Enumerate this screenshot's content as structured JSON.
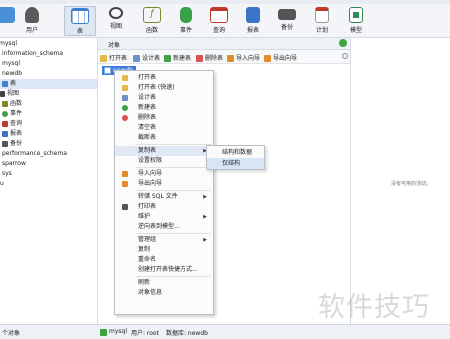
{
  "window": {
    "top_menu_fragments": [
      "...",
      "...",
      "..."
    ]
  },
  "toolbar": {
    "items": [
      {
        "label": "",
        "icon": "connection-icon",
        "color": "#4a90d9"
      },
      {
        "label": "用户",
        "icon": "user-icon",
        "color": "#555555"
      },
      {
        "label": "表",
        "icon": "table-icon",
        "color": "#3f7fd0"
      },
      {
        "label": "视图",
        "icon": "view-icon",
        "color": "#444444"
      },
      {
        "label": "函数",
        "icon": "function-icon",
        "color": "#7a8a2a"
      },
      {
        "label": "事件",
        "icon": "event-icon",
        "color": "#3aa04a"
      },
      {
        "label": "查询",
        "icon": "query-icon",
        "color": "#c0392b"
      },
      {
        "label": "报表",
        "icon": "report-icon",
        "color": "#3b73c7"
      },
      {
        "label": "备份",
        "icon": "backup-icon",
        "color": "#555555"
      },
      {
        "label": "计划",
        "icon": "schedule-icon",
        "color": "#c0392b"
      },
      {
        "label": "模型",
        "icon": "model-icon",
        "color": "#2e8b57"
      }
    ]
  },
  "sidebar": {
    "rows": [
      {
        "label": "mysql",
        "icon": "database-icon",
        "indent": 0,
        "selected": false
      },
      {
        "label": "information_schema",
        "icon": "database-icon",
        "indent": 0,
        "selected": false
      },
      {
        "label": "mysql",
        "icon": "database-icon",
        "indent": 0,
        "selected": false
      },
      {
        "label": "newdb",
        "icon": "database-icon",
        "indent": 0,
        "selected": false
      },
      {
        "label": "表",
        "icon": "table-icon",
        "indent": 1,
        "selected": true
      },
      {
        "label": "视图",
        "icon": "view-icon",
        "indent": 1,
        "selected": false
      },
      {
        "label": "函数",
        "icon": "function-icon",
        "indent": 1,
        "selected": false
      },
      {
        "label": "事件",
        "icon": "event-icon",
        "indent": 1,
        "selected": false
      },
      {
        "label": "查询",
        "icon": "query-icon",
        "indent": 1,
        "selected": false
      },
      {
        "label": "报表",
        "icon": "report-icon",
        "indent": 1,
        "selected": false
      },
      {
        "label": "备份",
        "icon": "backup-icon",
        "indent": 1,
        "selected": false
      },
      {
        "label": "performance_schema",
        "icon": "database-icon",
        "indent": 0,
        "selected": false
      },
      {
        "label": "sparrow",
        "icon": "database-icon",
        "indent": 0,
        "selected": false
      },
      {
        "label": "sys",
        "icon": "database-icon",
        "indent": 0,
        "selected": false
      },
      {
        "label": "u",
        "icon": "database-icon",
        "indent": 0,
        "selected": false
      }
    ]
  },
  "objects": {
    "header": "对象",
    "toolbar": [
      {
        "label": "打开表",
        "icon": "open-table-icon"
      },
      {
        "label": "设计表",
        "icon": "design-table-icon"
      },
      {
        "label": "新建表",
        "icon": "new-table-icon"
      },
      {
        "label": "删除表",
        "icon": "delete-table-icon"
      },
      {
        "label": "导入向导",
        "icon": "import-icon"
      },
      {
        "label": "导出向导",
        "icon": "export-icon"
      }
    ],
    "selected_item": "newdb"
  },
  "context_menu": {
    "items": [
      {
        "label": "打开表",
        "icon": "open-table-icon",
        "submenu": false
      },
      {
        "label": "打开表 (快速)",
        "icon": "open-table-icon",
        "submenu": false
      },
      {
        "label": "设计表",
        "icon": "design-table-icon",
        "submenu": false
      },
      {
        "label": "新建表",
        "icon": "new-table-icon",
        "submenu": false
      },
      {
        "label": "删除表",
        "icon": "delete-table-icon",
        "submenu": false
      },
      {
        "label": "清空表",
        "icon": "",
        "submenu": false
      },
      {
        "label": "截断表",
        "icon": "",
        "submenu": false
      },
      {
        "label": "复制表",
        "icon": "",
        "submenu": true,
        "highlight": true
      },
      {
        "label": "设置权限",
        "icon": "",
        "submenu": false
      },
      {
        "label": "导入向导",
        "icon": "import-icon",
        "submenu": false
      },
      {
        "label": "导出向导",
        "icon": "export-icon",
        "submenu": false
      },
      {
        "label": "转储 SQL 文件",
        "icon": "",
        "submenu": true
      },
      {
        "label": "打印表",
        "icon": "print-icon",
        "submenu": false
      },
      {
        "label": "维护",
        "icon": "",
        "submenu": true
      },
      {
        "label": "逆向表到模型...",
        "icon": "",
        "submenu": false
      },
      {
        "label": "管理组",
        "icon": "",
        "submenu": true
      },
      {
        "label": "复制",
        "icon": "",
        "submenu": false
      },
      {
        "label": "重命名",
        "icon": "",
        "submenu": false
      },
      {
        "label": "创建打开表快捷方式...",
        "icon": "",
        "submenu": false
      },
      {
        "label": "刷新",
        "icon": "",
        "submenu": false
      },
      {
        "label": "对象信息",
        "icon": "",
        "submenu": false
      }
    ],
    "submenu": [
      {
        "label": "结构和数据",
        "highlight": false
      },
      {
        "label": "仅结构",
        "highlight": true
      }
    ]
  },
  "info_panel": {
    "text": "没有可用的活动。"
  },
  "statusbar": {
    "left": "个对象",
    "connection": "mysql",
    "user": "用户: root",
    "database": "数据库: newdb"
  },
  "watermark": "软件技巧"
}
